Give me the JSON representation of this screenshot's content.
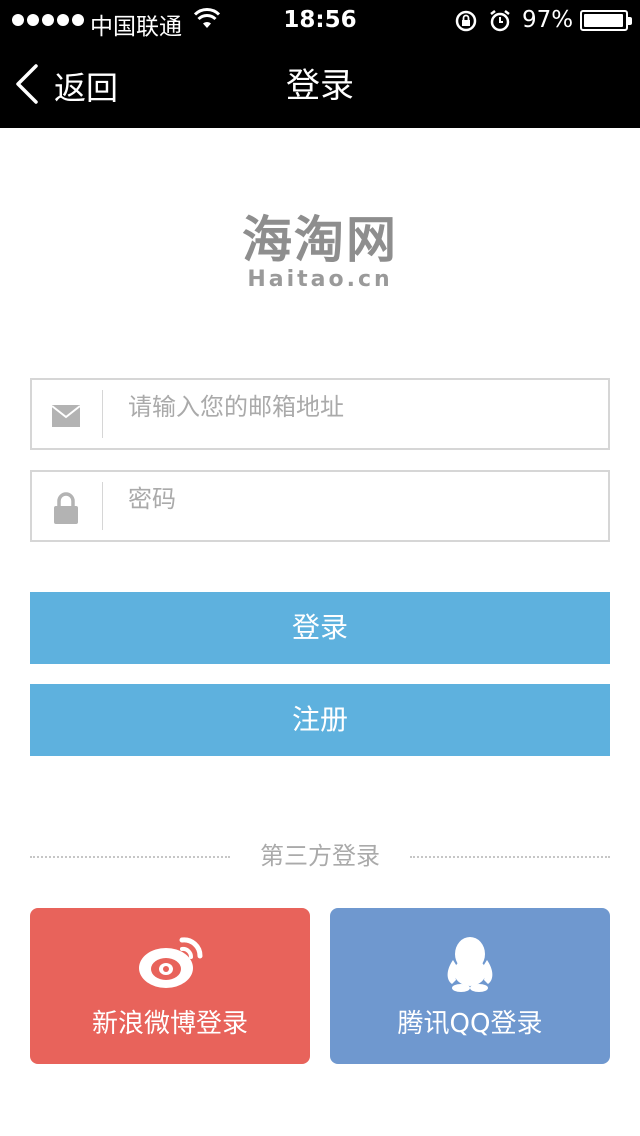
{
  "status_bar": {
    "carrier": "中国联通",
    "time": "18:56",
    "battery": "97%",
    "battery_level": 0.97
  },
  "nav": {
    "back_label": "返回",
    "title": "登录"
  },
  "logo": {
    "cn": "海淘网",
    "en": "Haitao.cn"
  },
  "form": {
    "email_placeholder": "请输入您的邮箱地址",
    "email_value": "",
    "password_placeholder": "密码",
    "password_value": "",
    "login_label": "登录",
    "register_label": "注册"
  },
  "third_party": {
    "heading": "第三方登录",
    "weibo_label": "新浪微博登录",
    "qq_label": "腾讯QQ登录"
  },
  "colors": {
    "primary_button": "#5eb1de",
    "weibo": "#e8635b",
    "qq": "#6f98cf",
    "topbar": "#000000"
  }
}
